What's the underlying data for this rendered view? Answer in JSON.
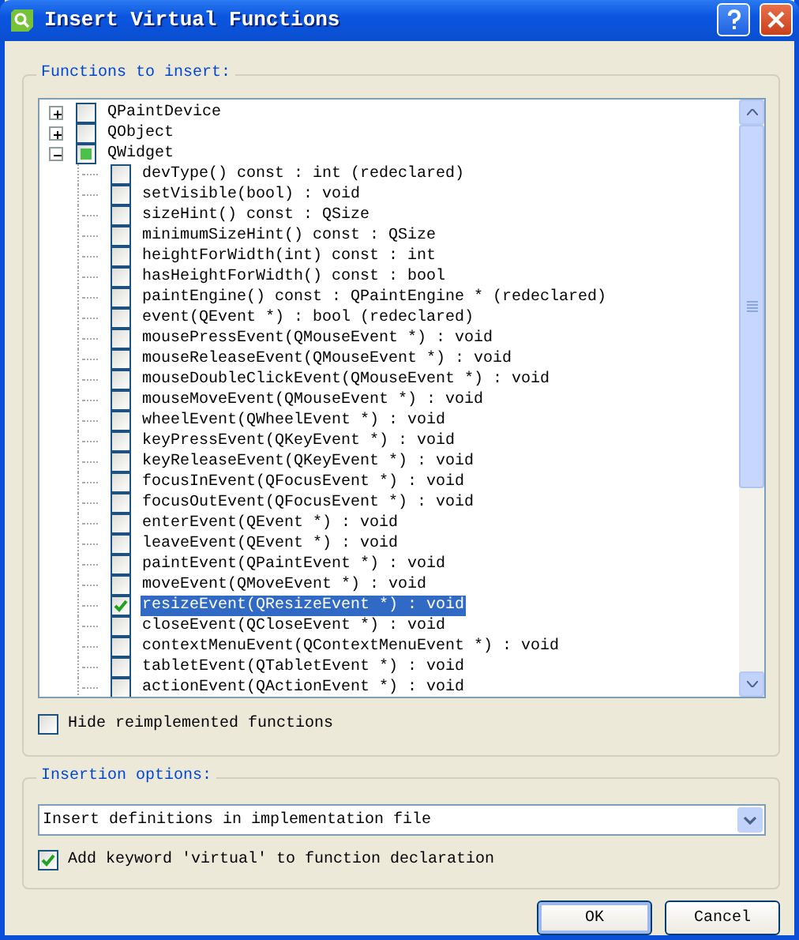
{
  "window": {
    "title": "Insert Virtual Functions"
  },
  "functions_group": {
    "title": "Functions to insert:",
    "tree": [
      {
        "label": "QPaintDevice",
        "expanded": false,
        "checked": false,
        "partial": false,
        "selected": false
      },
      {
        "label": "QObject",
        "expanded": false,
        "checked": false,
        "partial": false,
        "selected": false
      },
      {
        "label": "QWidget",
        "expanded": true,
        "checked": false,
        "partial": true,
        "selected": false,
        "children": [
          {
            "label": "devType() const : int (redeclared)",
            "checked": false,
            "selected": false
          },
          {
            "label": "setVisible(bool) : void",
            "checked": false,
            "selected": false
          },
          {
            "label": "sizeHint() const : QSize",
            "checked": false,
            "selected": false
          },
          {
            "label": "minimumSizeHint() const : QSize",
            "checked": false,
            "selected": false
          },
          {
            "label": "heightForWidth(int) const : int",
            "checked": false,
            "selected": false
          },
          {
            "label": "hasHeightForWidth() const : bool",
            "checked": false,
            "selected": false
          },
          {
            "label": "paintEngine() const : QPaintEngine * (redeclared)",
            "checked": false,
            "selected": false
          },
          {
            "label": "event(QEvent *) : bool (redeclared)",
            "checked": false,
            "selected": false
          },
          {
            "label": "mousePressEvent(QMouseEvent *) : void",
            "checked": false,
            "selected": false
          },
          {
            "label": "mouseReleaseEvent(QMouseEvent *) : void",
            "checked": false,
            "selected": false
          },
          {
            "label": "mouseDoubleClickEvent(QMouseEvent *) : void",
            "checked": false,
            "selected": false
          },
          {
            "label": "mouseMoveEvent(QMouseEvent *) : void",
            "checked": false,
            "selected": false
          },
          {
            "label": "wheelEvent(QWheelEvent *) : void",
            "checked": false,
            "selected": false
          },
          {
            "label": "keyPressEvent(QKeyEvent *) : void",
            "checked": false,
            "selected": false
          },
          {
            "label": "keyReleaseEvent(QKeyEvent *) : void",
            "checked": false,
            "selected": false
          },
          {
            "label": "focusInEvent(QFocusEvent *) : void",
            "checked": false,
            "selected": false
          },
          {
            "label": "focusOutEvent(QFocusEvent *) : void",
            "checked": false,
            "selected": false
          },
          {
            "label": "enterEvent(QEvent *) : void",
            "checked": false,
            "selected": false
          },
          {
            "label": "leaveEvent(QEvent *) : void",
            "checked": false,
            "selected": false
          },
          {
            "label": "paintEvent(QPaintEvent *) : void",
            "checked": false,
            "selected": false
          },
          {
            "label": "moveEvent(QMoveEvent *) : void",
            "checked": false,
            "selected": false
          },
          {
            "label": "resizeEvent(QResizeEvent *) : void",
            "checked": true,
            "selected": true
          },
          {
            "label": "closeEvent(QCloseEvent *) : void",
            "checked": false,
            "selected": false
          },
          {
            "label": "contextMenuEvent(QContextMenuEvent *) : void",
            "checked": false,
            "selected": false
          },
          {
            "label": "tabletEvent(QTabletEvent *) : void",
            "checked": false,
            "selected": false
          },
          {
            "label": "actionEvent(QActionEvent *) : void",
            "checked": false,
            "selected": false
          }
        ]
      }
    ],
    "hide_reimplemented": {
      "label": "Hide reimplemented functions",
      "checked": false
    }
  },
  "insertion_group": {
    "title": "Insertion options:",
    "mode": {
      "value": "Insert definitions in implementation file"
    },
    "add_virtual": {
      "label": "Add keyword 'virtual' to function declaration",
      "checked": true
    }
  },
  "buttons": [
    {
      "label": "OK",
      "default": true
    },
    {
      "label": "Cancel",
      "default": false
    }
  ]
}
